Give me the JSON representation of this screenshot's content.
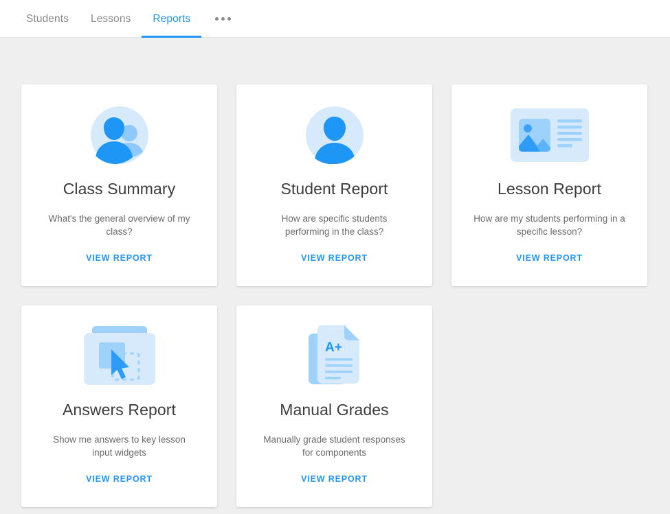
{
  "nav": {
    "tabs": [
      {
        "label": "Students",
        "active": false,
        "name": "tab-students"
      },
      {
        "label": "Lessons",
        "active": false,
        "name": "tab-lessons"
      },
      {
        "label": "Reports",
        "active": true,
        "name": "tab-reports"
      }
    ],
    "more_label": "more-options"
  },
  "colors": {
    "accent": "#2196f3",
    "icon_primary": "#1e96f5",
    "icon_secondary": "#8ec9fa",
    "icon_bg": "#d6eafb",
    "page_bg": "#efefef",
    "card_bg": "#ffffff",
    "title_text": "#3c3c3c",
    "desc_text": "#6b6b6b",
    "tab_inactive": "#8a8a8a"
  },
  "cards": [
    {
      "id": "class-summary",
      "icon": "two-people-avatar-icon",
      "title": "Class Summary",
      "description": "What's the general overview of my class?",
      "link_label": "VIEW REPORT"
    },
    {
      "id": "student-report",
      "icon": "single-person-avatar-icon",
      "title": "Student Report",
      "description": "How are specific students performing in the class?",
      "link_label": "VIEW REPORT"
    },
    {
      "id": "lesson-report",
      "icon": "lesson-article-icon",
      "title": "Lesson Report",
      "description": "How are my students performing in a specific lesson?",
      "link_label": "VIEW REPORT"
    },
    {
      "id": "answers-report",
      "icon": "drag-drop-widget-icon",
      "title": "Answers Report",
      "description": "Show me answers to key lesson input widgets",
      "link_label": "VIEW REPORT"
    },
    {
      "id": "manual-grades",
      "icon": "graded-document-icon",
      "title": "Manual Grades",
      "description": "Manually grade student responses for components",
      "link_label": "VIEW REPORT"
    }
  ]
}
